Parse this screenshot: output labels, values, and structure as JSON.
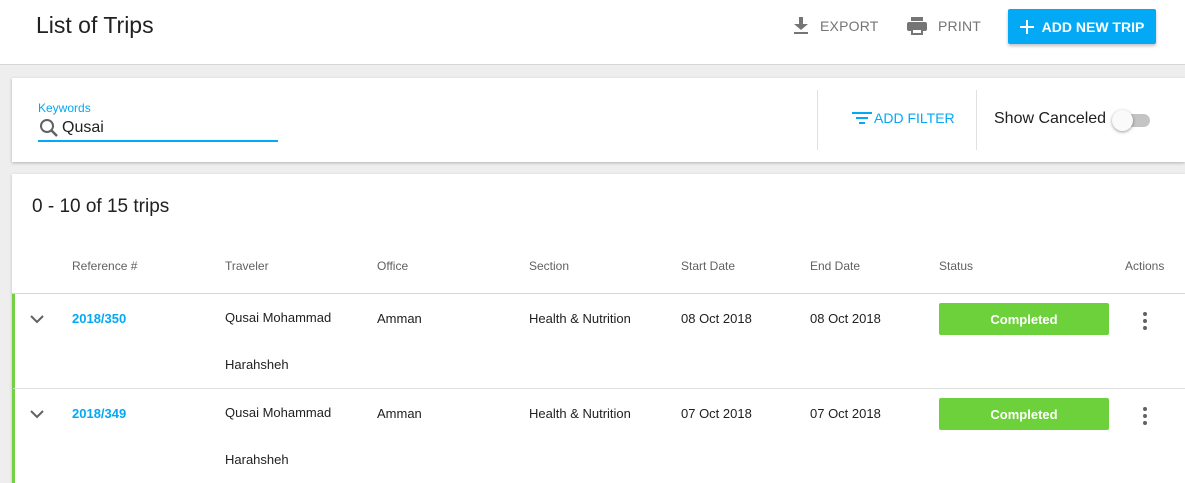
{
  "header": {
    "title": "List of Trips",
    "export_label": "EXPORT",
    "print_label": "PRINT",
    "add_label": "ADD NEW TRIP",
    "accent_color": "#03a9f4"
  },
  "filters": {
    "keywords_label": "Keywords",
    "keywords_value": "Qusai",
    "add_filter_label": "ADD FILTER",
    "show_canceled_label": "Show Canceled",
    "show_canceled_on": false
  },
  "table": {
    "count_text": "0 - 10 of 15 trips",
    "columns": [
      "Reference #",
      "Traveler",
      "Office",
      "Section",
      "Start Date",
      "End Date",
      "Status",
      "Actions"
    ],
    "rows": [
      {
        "reference": "2018/350",
        "traveler_line1": "Qusai Mohammad",
        "traveler_line2": "Harahsheh",
        "office": "Amman",
        "section": "Health & Nutrition",
        "start_date": "08 Oct 2018",
        "end_date": "08 Oct 2018",
        "status": "Completed"
      },
      {
        "reference": "2018/349",
        "traveler_line1": "Qusai Mohammad",
        "traveler_line2": "Harahsheh",
        "office": "Amman",
        "section": "Health & Nutrition",
        "start_date": "07 Oct 2018",
        "end_date": "07 Oct 2018",
        "status": "Completed"
      }
    ],
    "status_color": "#6cd13a"
  }
}
